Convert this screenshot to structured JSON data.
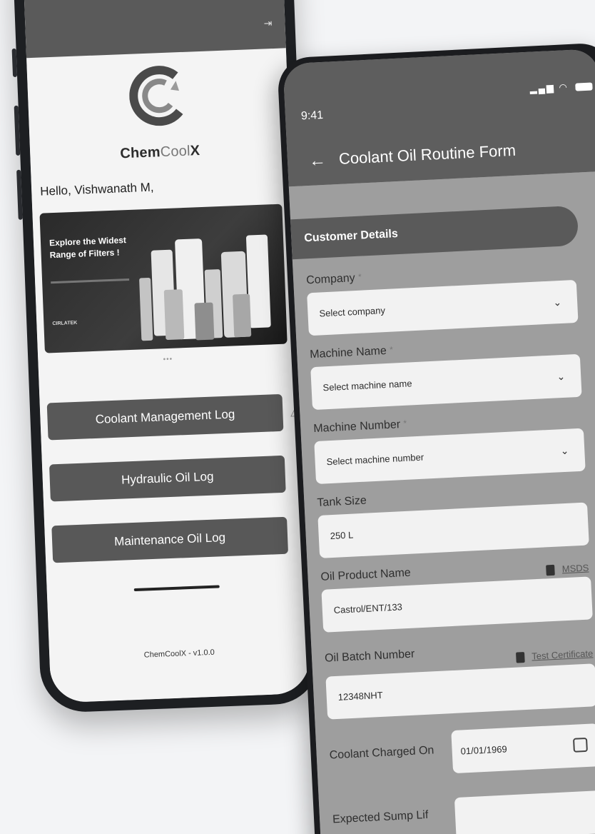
{
  "back_phone": {
    "brand": {
      "bold": "ChemCool",
      "x": "X",
      "cool": "Cool",
      "chem": "Chem"
    },
    "greeting": "Hello, Vishwanath M,",
    "banner": {
      "title": "Explore the Widest Range of Filters !",
      "brand": "CIRLATEK"
    },
    "carousel_dots": "•••",
    "buttons": [
      {
        "label": "Coolant Management Log"
      },
      {
        "label": "Hydraulic Oil Log"
      },
      {
        "label": "Maintenance Oil Log"
      }
    ],
    "version": "ChemCoolX - v1.0.0"
  },
  "front_phone": {
    "status": {
      "time": "9:41"
    },
    "title": "Coolant Oil Routine Form",
    "section": "Customer Details",
    "fields": {
      "company": {
        "label": "Company",
        "placeholder": "Select company"
      },
      "machine_name": {
        "label": "Machine Name",
        "placeholder": "Select machine name"
      },
      "machine_number": {
        "label": "Machine Number",
        "placeholder": "Select machine number"
      },
      "tank_size": {
        "label": "Tank Size",
        "value": "250 L"
      },
      "oil_product": {
        "label": "Oil Product Name",
        "value": "Castrol/ENT/133",
        "link": "MSDS"
      },
      "oil_batch": {
        "label": "Oil Batch Number",
        "value": "12348NHT",
        "link": "Test Certificate"
      },
      "coolant_charged": {
        "label": "Coolant Charged On",
        "value": "01/01/1969"
      },
      "expected_sump": {
        "label": "Expected Sump Lif"
      }
    },
    "required_mark": "*"
  },
  "colors": {
    "header": "#5e5e5e",
    "button": "#585858",
    "form_bg": "#9e9e9e",
    "input_bg": "#f2f2f2"
  }
}
